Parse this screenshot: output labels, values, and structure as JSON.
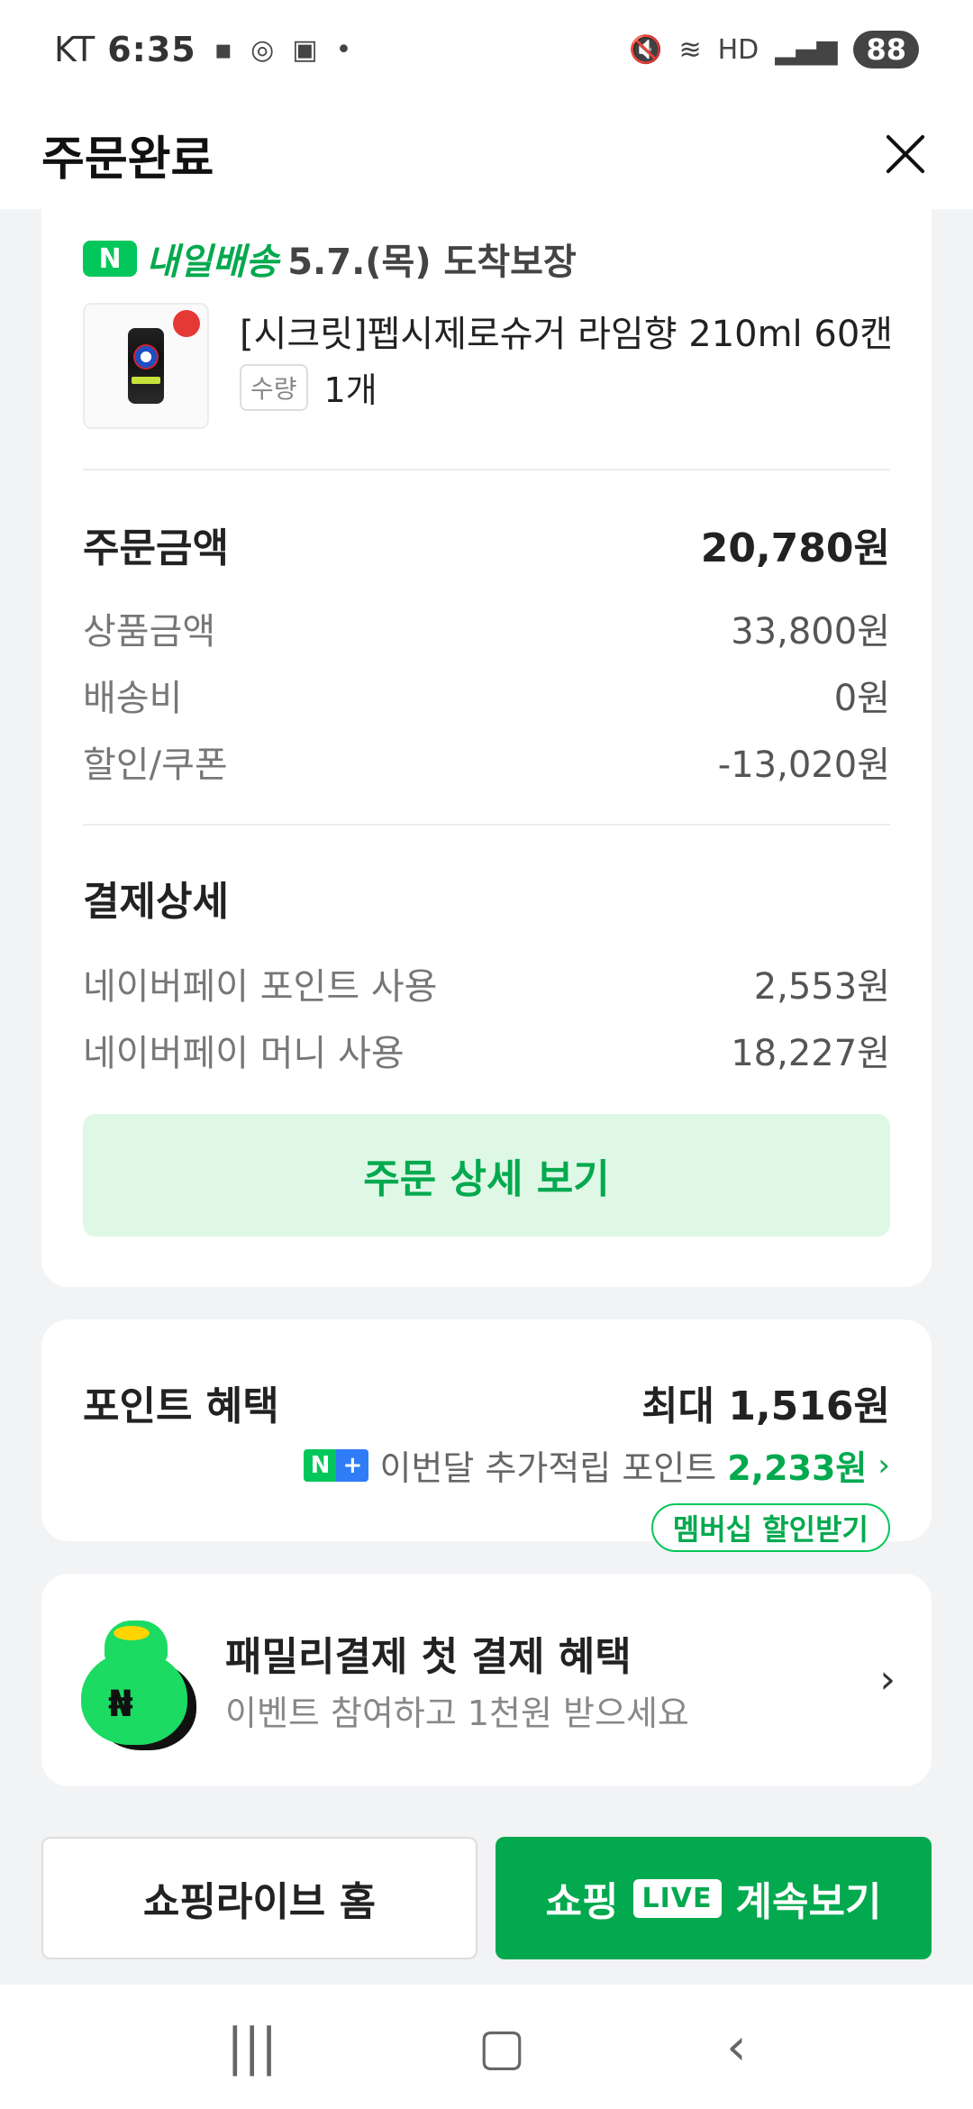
{
  "status_bar": {
    "carrier": "KT",
    "time": "6:35",
    "battery": "88"
  },
  "header": {
    "title": "주문완료"
  },
  "order": {
    "delivery_badge": "N",
    "delivery_label": "내일배송",
    "delivery_date": "5.7.(목) 도착보장",
    "product_name": "[시크릿]펩시제로슈거 라임향 210ml 60캔",
    "quantity_label": "수량",
    "quantity_value": "1개",
    "order_amount_label": "주문금액",
    "order_amount_value": "20,780원",
    "rows": [
      {
        "label": "상품금액",
        "value": "33,800원"
      },
      {
        "label": "배송비",
        "value": "0원"
      },
      {
        "label": "할인/쿠폰",
        "value": "-13,020원"
      }
    ],
    "payment_title": "결제상세",
    "payment_rows": [
      {
        "label": "네이버페이 포인트 사용",
        "value": "2,553원"
      },
      {
        "label": "네이버페이 머니 사용",
        "value": "18,227원"
      }
    ],
    "detail_button": "주문 상세 보기"
  },
  "points": {
    "title": "포인트 혜택",
    "max": "최대 1,516원",
    "extra_label": "이번달 추가적립 포인트",
    "extra_amount": "2,233원",
    "membership_button": "멤버십 할인받기"
  },
  "family": {
    "title": "패밀리결제 첫 결제 혜택",
    "subtitle": "이벤트 참여하고 1천원 받으세요"
  },
  "buttons": {
    "home": "쇼핑라이브 홈",
    "live_prefix": "쇼핑",
    "live_badge": "LIVE",
    "live_suffix": "계속보기"
  },
  "colors": {
    "accent": "#03c75a",
    "accent_dark": "#03a94e",
    "background": "#f2f3f5"
  }
}
